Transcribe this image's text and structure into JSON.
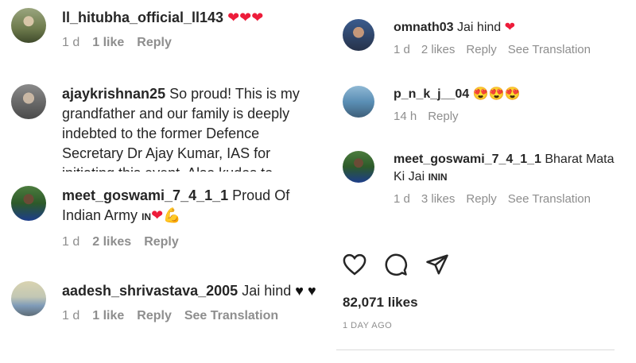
{
  "left_comments": [
    {
      "username": "ll_hitubha_official_ll143",
      "text": "",
      "emoji": "❤❤❤",
      "time": "1 d",
      "likes": "1 like",
      "reply": "Reply"
    },
    {
      "username": "ajaykrishnan25",
      "text": "So proud! This is my grandfather and our family is deeply indebted to the former Defence Secretary Dr Ajay Kumar, IAS for initiating this event. Also kudos to",
      "time": "",
      "likes": "",
      "reply": ""
    },
    {
      "username": "meet_goswami_7_4_1_1",
      "text": "Proud Of Indian Army",
      "flag": "IN",
      "emoji": "❤💪",
      "time": "1 d",
      "likes": "2 likes",
      "reply": "Reply"
    },
    {
      "username": "aadesh_shrivastava_2005",
      "text": "Jai hind",
      "emoji": "♥ ♥",
      "time": "1 d",
      "likes": "1 like",
      "reply": "Reply",
      "translate": "See Translation"
    }
  ],
  "right_comments": [
    {
      "username": "omnath03",
      "text": "Jai hind",
      "emoji": "❤",
      "time": "1 d",
      "likes": "2 likes",
      "reply": "Reply",
      "translate": "See Translation"
    },
    {
      "username": "p_n_k_j__04",
      "text": "",
      "emoji": "😍😍😍",
      "time": "14 h",
      "reply": "Reply"
    },
    {
      "username": "meet_goswami_7_4_1_1",
      "text": "Bharat Mata Ki Jai",
      "flag": "ININ",
      "time": "1 d",
      "likes": "3 likes",
      "reply": "Reply",
      "translate": "See Translation"
    }
  ],
  "post": {
    "like_icon": "heart-outline-icon",
    "comment_icon": "comment-bubble-icon",
    "share_icon": "paper-plane-icon",
    "likes": "82,071 likes",
    "date": "1 DAY AGO"
  },
  "colors": {
    "text": "#262626",
    "meta": "#8e8e8e",
    "heart": "#ed1c3a",
    "divider": "#dbdbdb"
  }
}
